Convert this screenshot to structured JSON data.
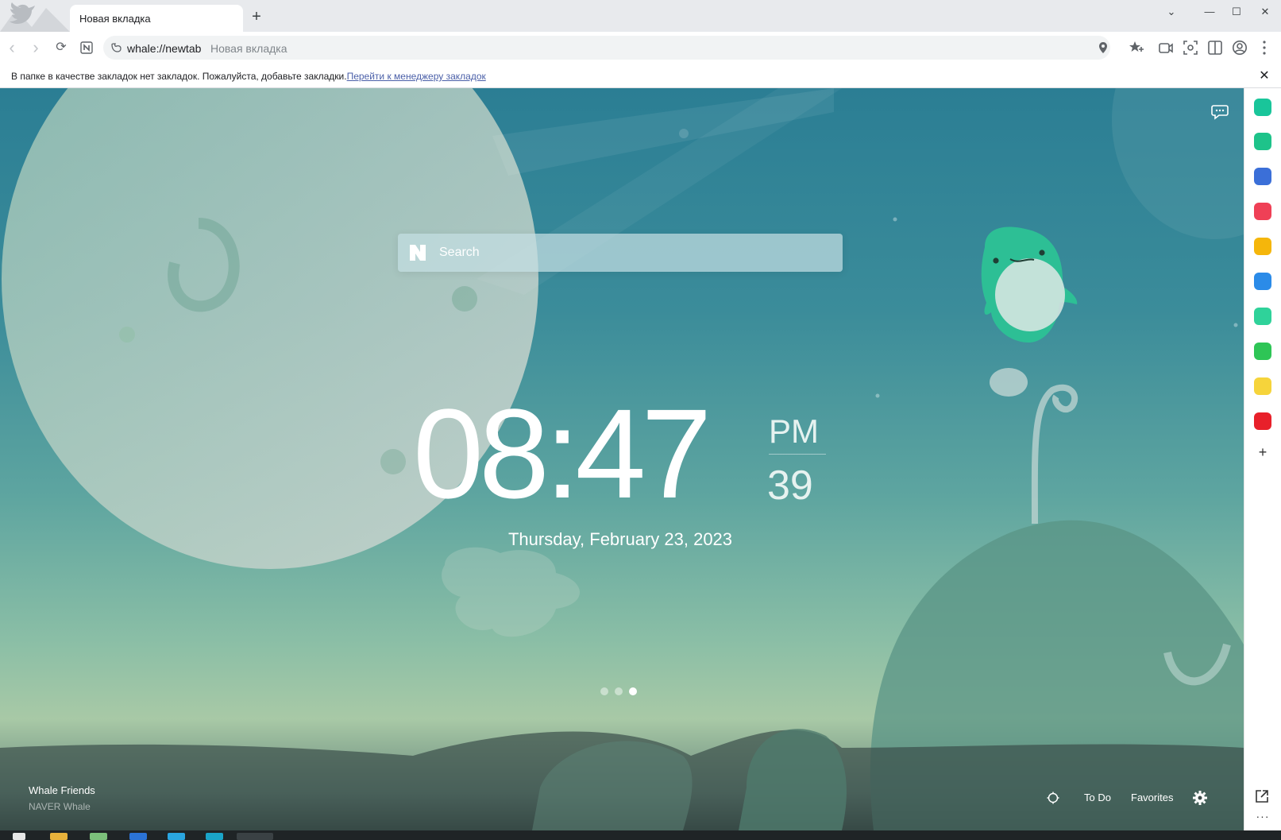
{
  "tab": {
    "title": "Новая вкладка",
    "new_tab_label": "+"
  },
  "window_controls": {
    "dropdown": "⌄",
    "minimize": "—",
    "maximize": "☐",
    "close": "✕"
  },
  "toolbar": {
    "back": "‹",
    "forward": "›",
    "reload": "⟳",
    "url": "whale://newtab",
    "page_title": "Новая вкладка"
  },
  "infobar": {
    "message": "В папке в качестве закладок нет закладок. Пожалуйста, добавьте закладки.",
    "link": "Перейти к менеджеру закладок",
    "close": "✕"
  },
  "search": {
    "placeholder": "Search"
  },
  "clock": {
    "time": "08:47",
    "ampm": "PM",
    "seconds": "39",
    "date": "Thursday, February 23, 2023"
  },
  "pagination": {
    "count": 3,
    "active_index": 2
  },
  "credit": {
    "title": "Whale Friends",
    "subtitle": "NAVER Whale"
  },
  "bottom_bar": {
    "todo": "To Do",
    "favorites": "Favorites"
  },
  "sidebar": {
    "icons": [
      {
        "name": "whale-home-icon",
        "color": "#19c59a"
      },
      {
        "name": "notification-icon",
        "color": "#1ec38a"
      },
      {
        "name": "briefcase-icon",
        "color": "#3b6fd8"
      },
      {
        "name": "pocket-icon",
        "color": "#ef4056"
      },
      {
        "name": "star-icon",
        "color": "#f5b60b"
      },
      {
        "name": "translate-icon",
        "color": "#2b8be8"
      },
      {
        "name": "play-icon",
        "color": "#2fd29a"
      },
      {
        "name": "webtoon-icon",
        "color": "#2ec556"
      },
      {
        "name": "memo-icon",
        "color": "#f6d43b"
      },
      {
        "name": "now-icon",
        "color": "#e8202a"
      }
    ],
    "plus": "+",
    "more": "···"
  },
  "colors": {
    "accent": "#2b7e94",
    "clock_text": "#ffffff",
    "link": "#4a5fa8"
  }
}
